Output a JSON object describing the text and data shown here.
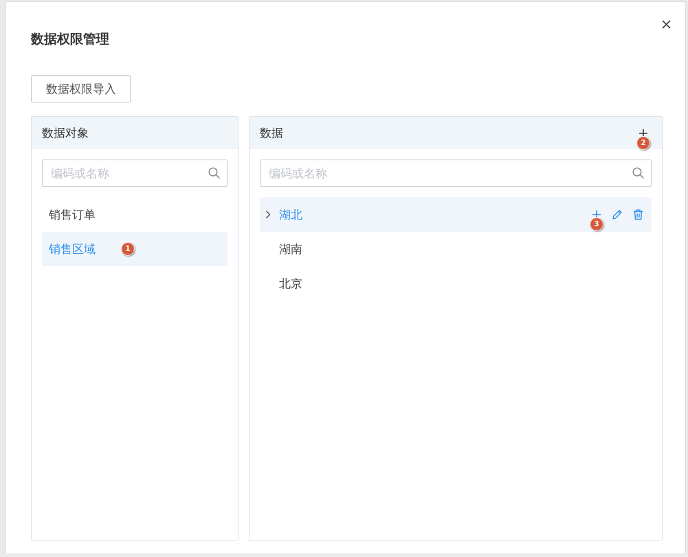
{
  "dialog": {
    "title": "数据权限管理",
    "import_button": "数据权限导入"
  },
  "objects_panel": {
    "title": "数据对象",
    "search": {
      "placeholder": "编码或名称"
    },
    "items": [
      {
        "label": "销售订单",
        "selected": false
      },
      {
        "label": "销售区域",
        "selected": true,
        "marker": "1"
      }
    ]
  },
  "data_panel": {
    "title": "数据",
    "add_marker": "2",
    "search": {
      "placeholder": "编码或名称"
    },
    "tree": [
      {
        "kind": "branch",
        "label": "湖北",
        "expanded": false,
        "selected": true,
        "marker": "3"
      },
      {
        "kind": "leaf",
        "label": "湖南",
        "selected": false
      },
      {
        "kind": "leaf",
        "label": "北京",
        "selected": false
      }
    ]
  }
}
